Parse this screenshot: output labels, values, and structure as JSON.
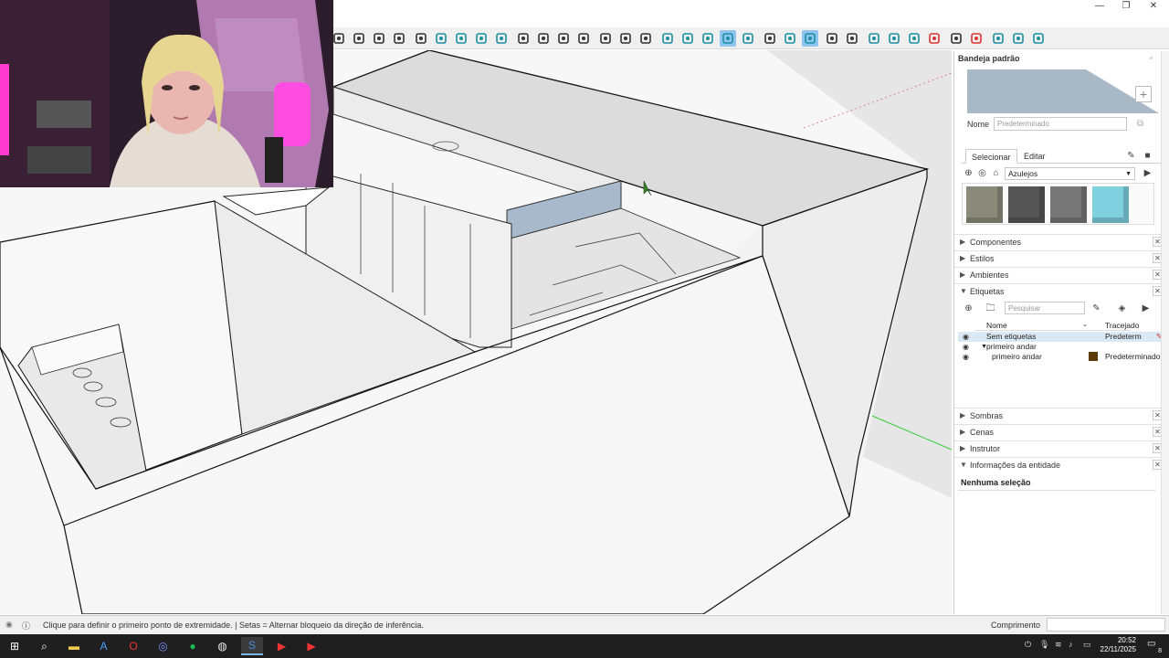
{
  "window": {
    "minimize_glyph": "—",
    "maximize_glyph": "❐",
    "close_glyph": "✕"
  },
  "toolbar": {
    "tools": [
      "paint-icon",
      "orbit-icon",
      "pan-icon",
      "zoom-icon",
      "zoom-extents-icon",
      "section-plane-icon",
      "section-display-icon",
      "section-cut-icon",
      "section-fill-icon",
      "walk-icon",
      "camera-icon",
      "document-icon",
      "position-camera-icon",
      "folder-icon",
      "settings-icon",
      "close-icon",
      "drop-outline-icon",
      "drop-half-icon",
      "drop-fill-icon",
      "drop-active-icon",
      "drop-strike-icon",
      "snap-off-icon",
      "magnet-icon",
      "magnet-active-icon",
      "add-point-icon",
      "line-point-icon",
      "cube-outline-icon",
      "cube-wire-icon",
      "cube-solid-icon",
      "cube-red-icon",
      "axes-icon",
      "rotate-red-icon",
      "grid-a-icon",
      "grid-b-icon",
      "grid-c-icon"
    ]
  },
  "viewport": {
    "background": "#f7f7f7"
  },
  "panel": {
    "title": "Bandeja padrão",
    "materials": {
      "name_label": "Nome",
      "name_placeholder": "Predeterminado",
      "preview_color": "#a9b8c6",
      "tabs": [
        "Selecionar",
        "Editar"
      ],
      "selected_tab": "Selecionar",
      "library": "Azulejos",
      "swatches": [
        "#8a8a7a",
        "#555555",
        "#777777",
        "#7fd1e0"
      ]
    },
    "sections_collapsed_top": [
      "Componentes",
      "Estilos",
      "Ambientes"
    ],
    "tags": {
      "title": "Etiquetas",
      "search_placeholder": "Pesquisar",
      "col_name": "Nome",
      "col_dash": "Tracejado",
      "rows": [
        {
          "name": "Sem etiquetas",
          "dash": "Predeterm",
          "indent": 0,
          "selected": true,
          "color": null
        },
        {
          "name": "primeiro andar",
          "dash": "",
          "indent": 1,
          "selected": false,
          "color": null,
          "group": true
        },
        {
          "name": "primeiro andar",
          "dash": "Predeterminado",
          "indent": 2,
          "selected": false,
          "color": "#5c3d0a"
        }
      ]
    },
    "sections_collapsed_bottom": [
      "Sombras",
      "Cenas",
      "Instrutor"
    ],
    "entity_info": {
      "title": "Informações da entidade",
      "empty_text": "Nenhuma seleção"
    }
  },
  "statusbar": {
    "message": "Clique para definir o primeiro ponto de extremidade. | Setas = Alternar bloqueio da direção de inferência.",
    "measurement_label": "Comprimento",
    "measurement_value": ""
  },
  "taskbar": {
    "apps": [
      "windows-start-icon",
      "search-icon",
      "file-explorer-icon",
      "app-a-icon",
      "opera-icon",
      "discord-icon",
      "spotify-icon",
      "chrome-icon",
      "sketchup-icon",
      "app-red-1-icon",
      "app-red-2-icon"
    ],
    "time": "20:52",
    "date": "22/11/2025",
    "notification_count": "8"
  }
}
